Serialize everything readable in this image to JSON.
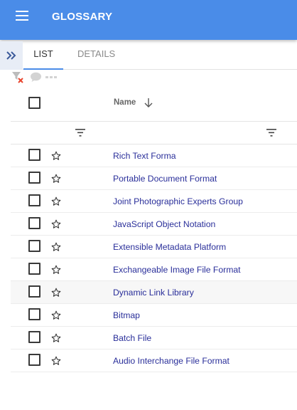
{
  "app": {
    "title": "GLOSSARY"
  },
  "tabs": [
    {
      "label": "LIST",
      "active": true
    },
    {
      "label": "DETAILS",
      "active": false
    }
  ],
  "table": {
    "name_header": "Name",
    "sort": "descending",
    "rows": [
      {
        "name": "Rich Text Forma"
      },
      {
        "name": "Portable Document Format"
      },
      {
        "name": "Joint Photographic Experts Group"
      },
      {
        "name": "JavaScript Object Notation"
      },
      {
        "name": "Extensible Metadata Platform"
      },
      {
        "name": "Exchangeable Image File Format"
      },
      {
        "name": "Dynamic Link Library",
        "highlighted": true
      },
      {
        "name": "Bitmap"
      },
      {
        "name": "Batch File"
      },
      {
        "name": "Audio Interchange File Format"
      }
    ]
  },
  "colors": {
    "appbar": "#4a8ce8",
    "link": "#2a2f9a",
    "clear_filter_x": "#e8442c"
  },
  "icons": [
    "menu-icon",
    "expand-panel-icon",
    "clear-filter-icon",
    "comment-icon",
    "more-icon",
    "sort-arrow-down-icon",
    "filter-icon",
    "star-icon"
  ]
}
